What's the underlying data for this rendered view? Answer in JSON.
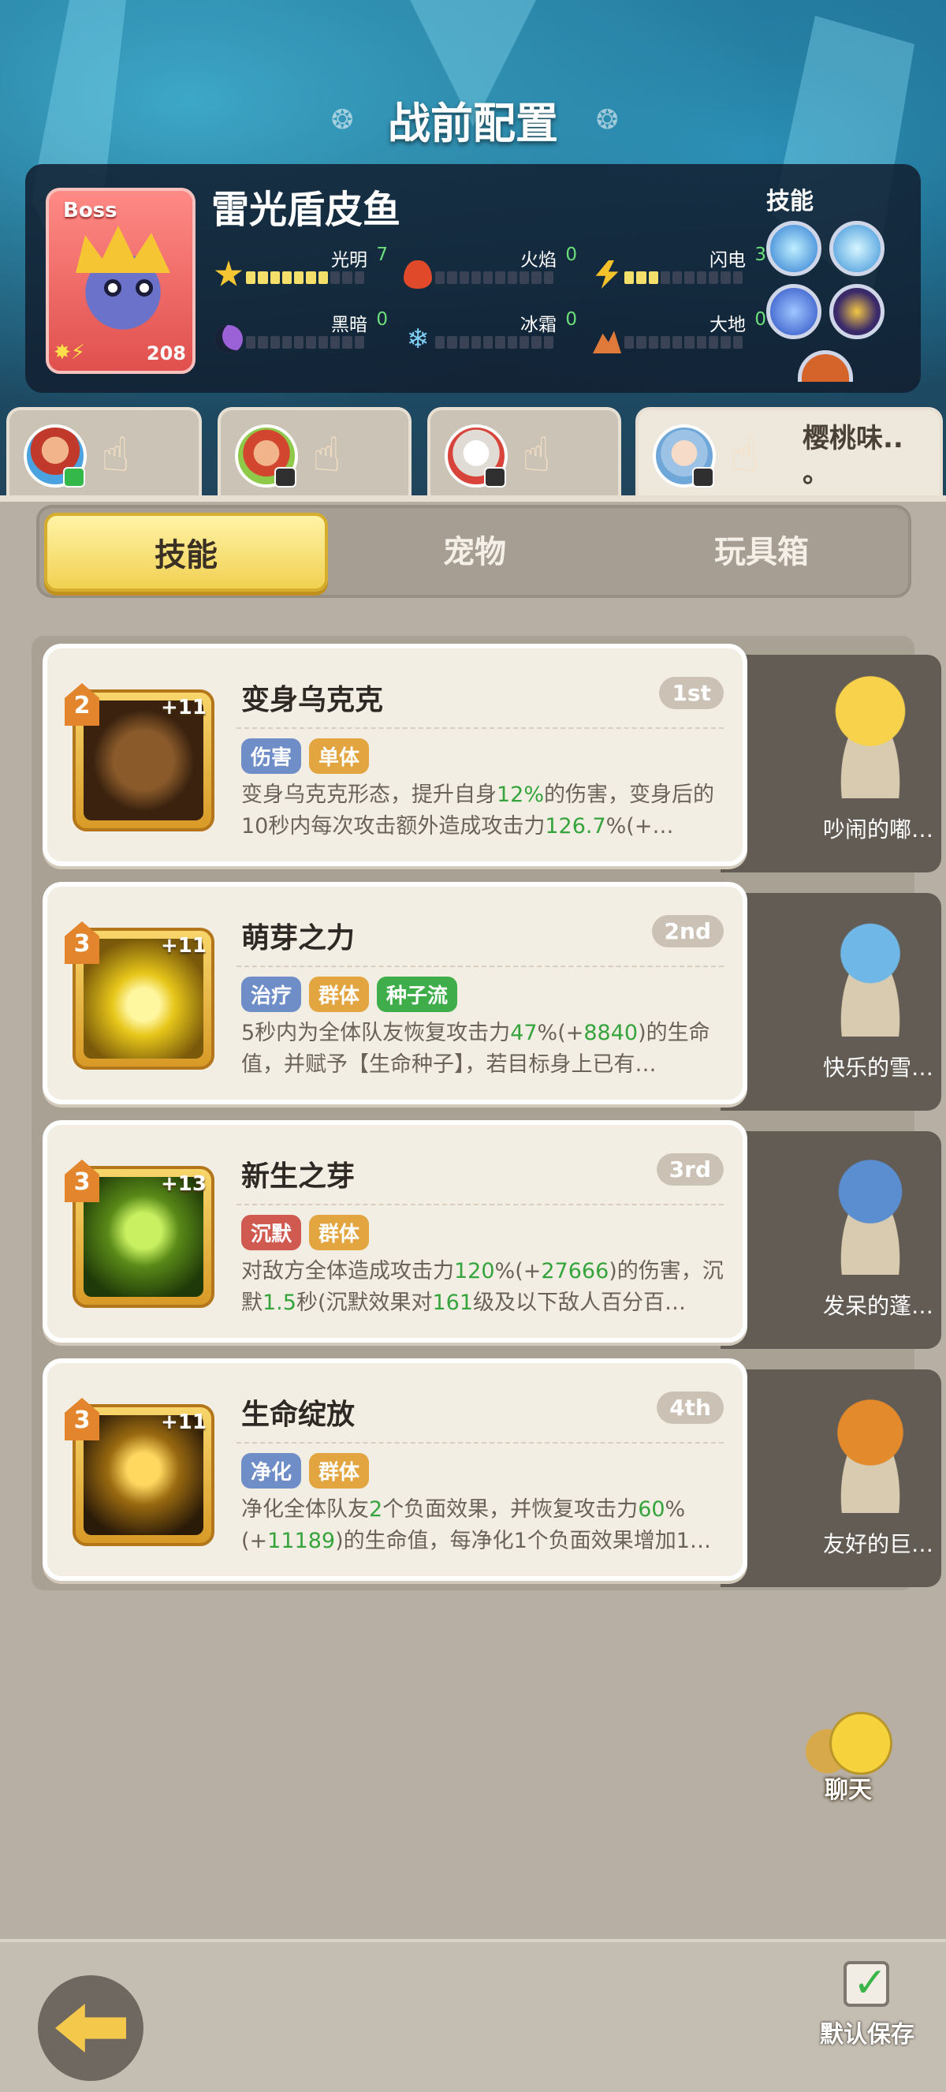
{
  "header": {
    "title": "战前配置"
  },
  "boss": {
    "label": "Boss",
    "name": "雷光盾皮鱼",
    "level": "208",
    "skills_label": "技能",
    "elements": [
      {
        "name": "光明",
        "value": "7",
        "icon": "sun-icon",
        "level": 7,
        "color": "#f5c533"
      },
      {
        "name": "火焰",
        "value": "0",
        "icon": "flame-icon",
        "level": 0,
        "color": "#e04a2a"
      },
      {
        "name": "闪电",
        "value": "3",
        "icon": "lightning-icon",
        "level": 3,
        "color": "#f6c22c"
      },
      {
        "name": "黑暗",
        "value": "0",
        "icon": "moon-icon",
        "level": 0,
        "color": "#9a62d6"
      },
      {
        "name": "冰霜",
        "value": "0",
        "icon": "snowflake-icon",
        "level": 0,
        "color": "#7fd0f4"
      },
      {
        "name": "大地",
        "value": "0",
        "icon": "mountain-icon",
        "level": 0,
        "color": "#e07a3a"
      }
    ]
  },
  "team": {
    "active_name": "樱桃味.. 。"
  },
  "tabs": [
    {
      "label": "技能"
    },
    {
      "label": "宠物"
    },
    {
      "label": "玩具箱"
    }
  ],
  "skills": [
    {
      "title": "变身乌克克",
      "rank": "1st",
      "level": "2",
      "plus": "+11",
      "tags": [
        "伤害",
        "单体"
      ],
      "desc": [
        "变身乌克克形态，提升自身",
        "12%",
        "的伤害，变身后的10秒内每次攻击额外造成攻击力",
        "126.7",
        "%(+…"
      ],
      "pet": "吵闹的嘟…"
    },
    {
      "title": "萌芽之力",
      "rank": "2nd",
      "level": "3",
      "plus": "+11",
      "tags": [
        "治疗",
        "群体",
        "种子流"
      ],
      "desc": [
        "5秒内为全体队友恢复攻击力",
        "47",
        "%(+",
        "8840",
        ")的生命值，并赋予【生命种子】，若目标身上已有…"
      ],
      "pet": "快乐的雪…"
    },
    {
      "title": "新生之芽",
      "rank": "3rd",
      "level": "3",
      "plus": "+13",
      "tags": [
        "沉默",
        "群体"
      ],
      "desc": [
        "对敌方全体造成攻击力",
        "120",
        "%(+",
        "27666",
        ")的伤害，沉默",
        "1.5",
        "秒(沉默效果对",
        "161",
        "级及以下敌人百分百…"
      ],
      "pet": "发呆的蓬…"
    },
    {
      "title": "生命绽放",
      "rank": "4th",
      "level": "3",
      "plus": "+11",
      "tags": [
        "净化",
        "群体"
      ],
      "desc": [
        "净化全体队友",
        "2",
        "个负面效果，并恢复攻击力",
        "60",
        "%(+",
        "11189",
        ")的生命值，每净化1个负面效果增加1…"
      ],
      "pet": "友好的巨…"
    }
  ],
  "chat": {
    "label": "聊天"
  },
  "footer": {
    "save_label": "默认保存",
    "save_checked": true
  }
}
